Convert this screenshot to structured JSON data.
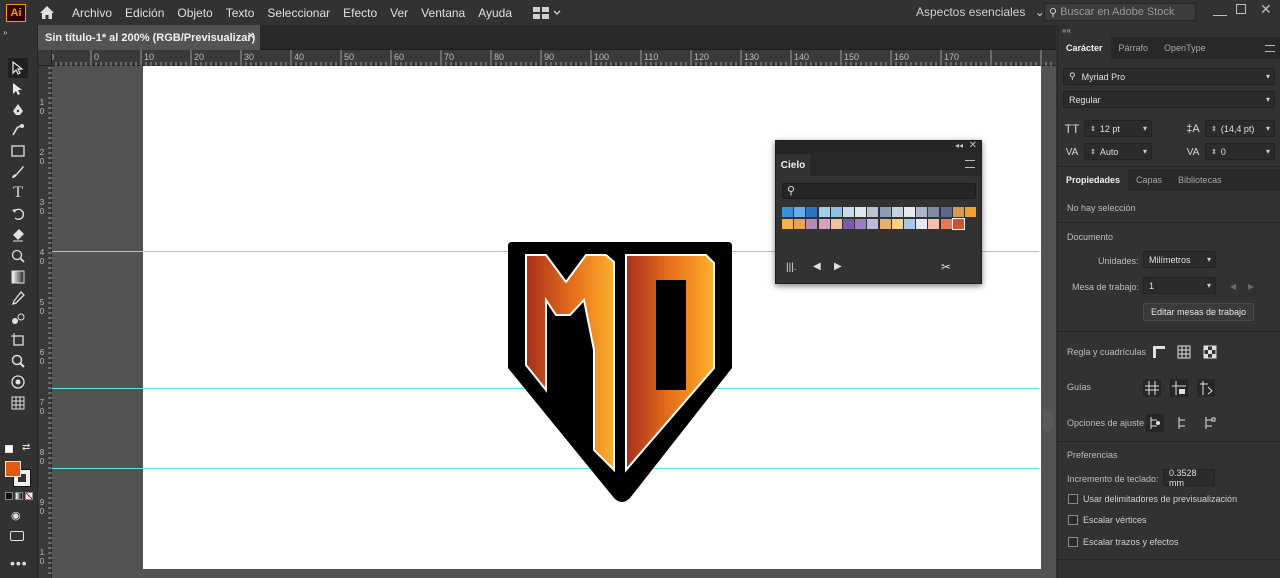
{
  "app": {
    "logo": "Ai"
  },
  "menu": [
    "Archivo",
    "Edición",
    "Objeto",
    "Texto",
    "Seleccionar",
    "Efecto",
    "Ver",
    "Ventana",
    "Ayuda"
  ],
  "workspace": {
    "label": "Aspectos esenciales"
  },
  "stock_search": {
    "placeholder": "Buscar en Adobe Stock"
  },
  "document": {
    "tab_title": "Sin título-1* al 200% (RGB/Previsualizar)",
    "close": "×"
  },
  "ruler": {
    "h_labels": [
      "10",
      "0",
      "10",
      "20",
      "30",
      "40",
      "50",
      "60",
      "70",
      "80",
      "90",
      "100",
      "110",
      "120",
      "130",
      "140",
      "150",
      "160",
      "170"
    ],
    "v_labels": [
      "1\n0",
      "2\n0",
      "3\n0",
      "4\n0",
      "5\n0",
      "6\n0",
      "7\n0",
      "8\n0",
      "9\n0",
      "1\n0"
    ]
  },
  "swatch_panel": {
    "tab": "Cielo",
    "row1": [
      "#3e8fd8",
      "#6aaee6",
      "#2d73c4",
      "#a6cdeb",
      "#8ec0e6",
      "#c9dcec",
      "#dfe6ee",
      "#b8c4d4",
      "#8c9cb4",
      "#c8d0dc",
      "#e6e8ee",
      "#aab4c6",
      "#7e8aa6",
      "#5c6a8a",
      "#d89a50",
      "#f0a030"
    ],
    "row2": [
      "#f6b24a",
      "#e8a45a",
      "#b48ab8",
      "#d8a0c0",
      "#f0c0a0",
      "#7c5aa6",
      "#9c7cc4",
      "#c0b8d8",
      "#e8b070",
      "#f4d090",
      "#a8c8e8",
      "#e4e8f0",
      "#f4c0a8",
      "#e87858",
      "#d05030"
    ]
  },
  "right_panel": {
    "tabs1": [
      "Carácter",
      "Párrafo",
      "OpenType"
    ],
    "font_family": "Myriad Pro",
    "font_style": "Regular",
    "font_size": "12 pt",
    "leading": "(14,4 pt)",
    "kerning": "Auto",
    "tracking": "0",
    "tabs2": [
      "Propiedades",
      "Capas",
      "Bibliotecas"
    ],
    "no_selection": "No hay selección",
    "document_section": "Documento",
    "units_label": "Unidades:",
    "units_value": "Milímetros",
    "artboard_label": "Mesa de trabajo:",
    "artboard_value": "1",
    "edit_artboards": "Editar mesas de trabajo",
    "rulers_grids": "Regla y cuadrículas",
    "guides": "Guías",
    "snap_options": "Opciones de ajuste",
    "preferences": "Preferencias",
    "keyboard_increment_label": "Incremento de teclado:",
    "keyboard_increment_value": "0.3528 mm",
    "checkboxes": [
      "Usar delimitadores de previsualización",
      "Escalar vértices",
      "Escalar trazos y efectos"
    ]
  },
  "colors": {
    "fill": "#e05a10",
    "guide": "#5fe0ea",
    "logo_orange": "#f59a1e",
    "logo_red": "#a8301c"
  }
}
